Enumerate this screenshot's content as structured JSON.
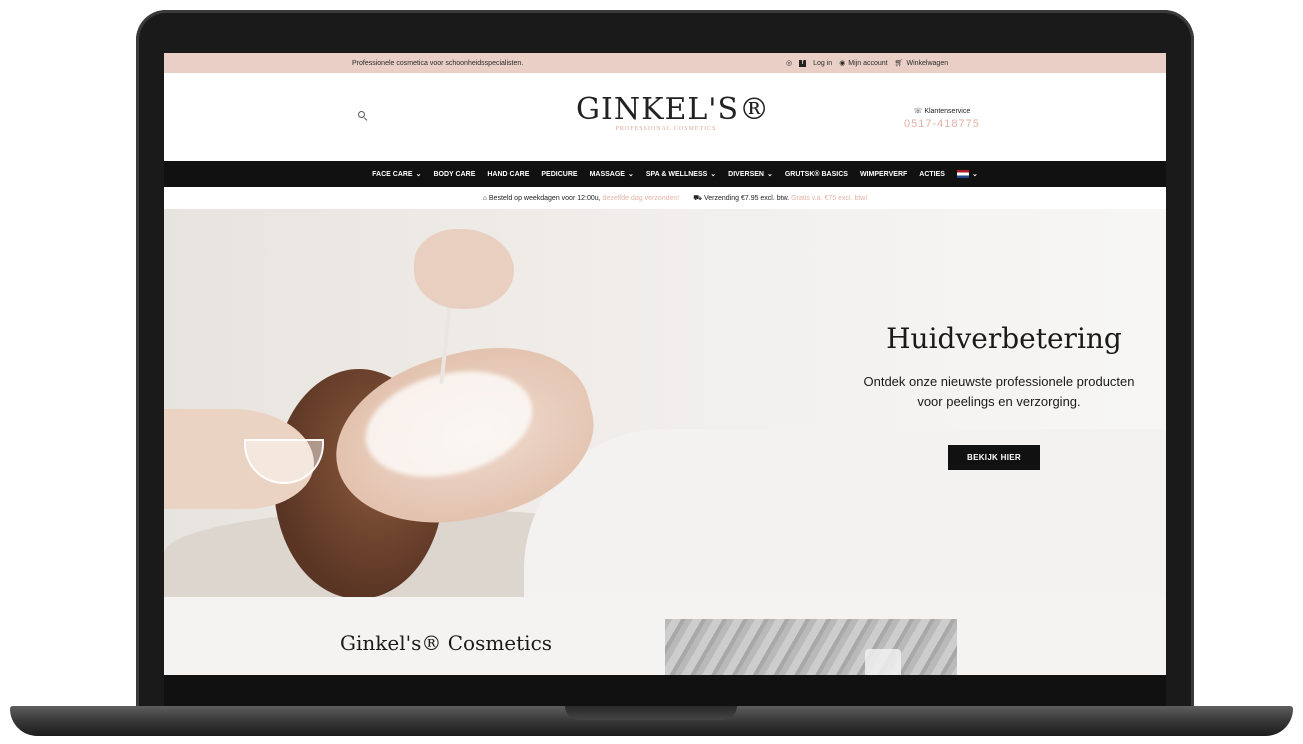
{
  "topbar": {
    "tagline": "Professionele cosmetica voor schoonheidsspecialisten.",
    "instagram_icon": "instagram-icon",
    "facebook_icon": "facebook-icon",
    "login": "Log in",
    "account": "Mijn account",
    "cart": "Winkelwagen"
  },
  "header": {
    "logo": "GINKEL'S®",
    "logo_sub": "PROFESSIONAL COSMETICS",
    "service_label": "Klantenservice",
    "phone": "0517-418775"
  },
  "nav": {
    "items": [
      {
        "label": "FACE CARE",
        "dropdown": true
      },
      {
        "label": "BODY CARE",
        "dropdown": false
      },
      {
        "label": "HAND CARE",
        "dropdown": false
      },
      {
        "label": "PEDICURE",
        "dropdown": false
      },
      {
        "label": "MASSAGE",
        "dropdown": true
      },
      {
        "label": "SPA & WELLNESS",
        "dropdown": true
      },
      {
        "label": "DIVERSEN",
        "dropdown": true
      },
      {
        "label": "GRUTSK® BASICS",
        "dropdown": false
      },
      {
        "label": "WIMPERVERF",
        "dropdown": false
      },
      {
        "label": "ACTIES",
        "dropdown": false
      }
    ],
    "chevron": "⌄"
  },
  "info": {
    "order_text": "Besteld op weekdagen voor 12:00u,",
    "order_highlight": "dezelfde dag verzonden!",
    "shipping_text": "Verzending €7.95 excl. btw.",
    "shipping_highlight": "Gratis v.a. €75 excl. btw!"
  },
  "hero": {
    "title": "Huidverbetering",
    "subtitle_line1": "Ontdek onze nieuwste professionele producten",
    "subtitle_line2": "voor peelings en verzorging.",
    "button": "BEKIJK HIER"
  },
  "section": {
    "title": "Ginkel's® Cosmetics"
  },
  "colors": {
    "topbar_bg": "#e9cfc6",
    "accent": "#e2b2a4",
    "nav_bg": "#111111"
  }
}
